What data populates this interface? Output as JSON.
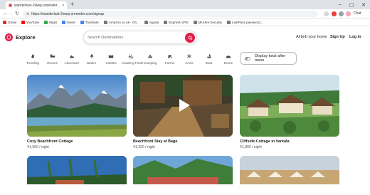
{
  "browser": {
    "tab_title": "wanderlust-2iwep.onrender.com",
    "tab_close": "×",
    "new_tab": "+",
    "url": "https://wanderlust-2iwep.onrender.com/signup",
    "bookmarks": [
      {
        "label": "Gmail",
        "color": "#d93025"
      },
      {
        "label": "YouTube",
        "color": "#ff0000"
      },
      {
        "label": "Maps",
        "color": "#34a853"
      },
      {
        "label": "News",
        "color": "#4285f4"
      },
      {
        "label": "Translate",
        "color": "#4285f4"
      },
      {
        "label": "Amazon.co.uk - On...",
        "color": "#777777"
      },
      {
        "label": "Agoda",
        "color": "#777777"
      },
      {
        "label": "Express VPN",
        "color": "#777777"
      },
      {
        "label": "McAfee Security",
        "color": "#777777"
      },
      {
        "label": "LastPass password...",
        "color": "#777777"
      }
    ],
    "profile_label": "Chat"
  },
  "header": {
    "brand": "Explore",
    "search_placeholder": "Search Destinations",
    "links": {
      "host": "Airbnb your home",
      "signup": "Sign Up",
      "login": "Log in"
    }
  },
  "categories": [
    {
      "label": "Trending",
      "icon": "fire-icon"
    },
    {
      "label": "Rooms",
      "icon": "bed-icon"
    },
    {
      "label": "Adventure",
      "icon": "mountain-icon"
    },
    {
      "label": "Nature",
      "icon": "tree-icon"
    },
    {
      "label": "Castles",
      "icon": "castle-icon"
    },
    {
      "label": "Amazing Pools",
      "icon": "pool-icon"
    },
    {
      "label": "Camping",
      "icon": "tent-icon"
    },
    {
      "label": "Farms",
      "icon": "tractor-icon"
    },
    {
      "label": "Arctic",
      "icon": "snowflake-icon"
    },
    {
      "label": "Boat",
      "icon": "boat-icon"
    },
    {
      "label": "Dome",
      "icon": "dome-icon"
    }
  ],
  "filter": {
    "label": "Display total after taxes"
  },
  "listings": [
    {
      "title": "Cozy Beachfront Cottage",
      "price": "₹1,500 / night"
    },
    {
      "title": "Beachfront Stay at Baga",
      "price": "₹1,200 / night"
    },
    {
      "title": "Cliffside Cottage in Varkala",
      "price": "₹1,800 / night"
    }
  ],
  "colors": {
    "brand": "#e11d48"
  }
}
